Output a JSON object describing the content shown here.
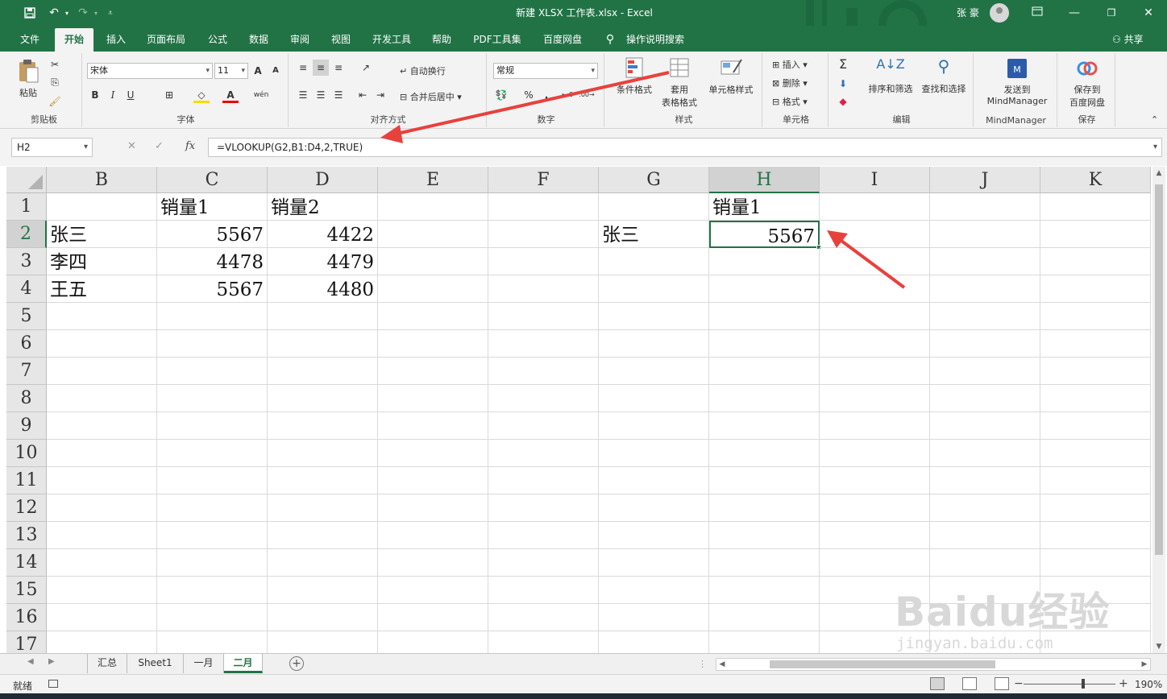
{
  "window": {
    "title": "新建 XLSX 工作表.xlsx  -  Excel",
    "user": "张 豪"
  },
  "menu": {
    "tabs": [
      "文件",
      "开始",
      "插入",
      "页面布局",
      "公式",
      "数据",
      "审阅",
      "视图",
      "开发工具",
      "帮助",
      "PDF工具集",
      "百度网盘",
      "操作说明搜索"
    ],
    "active_tab": "开始",
    "share": "共享"
  },
  "ribbon": {
    "clipboard": {
      "paste": "粘贴",
      "group": "剪贴板"
    },
    "font": {
      "name": "宋体",
      "size": "11",
      "group": "字体",
      "bold": "B",
      "italic": "I",
      "underline": "U",
      "grow": "A",
      "shrink": "A",
      "wen": "wén"
    },
    "alignment": {
      "wrap": "自动换行",
      "merge": "合并后居中",
      "group": "对齐方式"
    },
    "number": {
      "format": "常规",
      "percent": "%",
      "comma": ",",
      "group": "数字"
    },
    "styles": {
      "conditional": "条件格式",
      "table_line1": "套用",
      "table_line2": "表格格式",
      "cell": "单元格样式",
      "group": "样式"
    },
    "cells": {
      "insert": "插入",
      "delete": "删除",
      "format": "格式",
      "group": "单元格"
    },
    "editing": {
      "sort": "排序和筛选",
      "find": "查找和选择",
      "group": "编辑"
    },
    "mindmanager": {
      "line1": "发送到",
      "line2": "MindManager",
      "group": "MindManager"
    },
    "save": {
      "line1": "保存到",
      "line2": "百度网盘",
      "group": "保存"
    }
  },
  "formula_bar": {
    "name_box": "H2",
    "fx": "fx",
    "formula": "=VLOOKUP(G2,B1:D4,2,TRUE)"
  },
  "sheet": {
    "columns": [
      "B",
      "C",
      "D",
      "E",
      "F",
      "G",
      "H",
      "I",
      "J",
      "K"
    ],
    "selected_column": "H",
    "rows": [
      "1",
      "2",
      "3",
      "4",
      "5",
      "6",
      "7",
      "8",
      "9",
      "10",
      "11",
      "12",
      "13",
      "14",
      "15",
      "16",
      "17"
    ],
    "selected_row": "2",
    "cells": {
      "C1": "销量1",
      "D1": "销量2",
      "H1": "销量1",
      "B2": "张三",
      "C2": "5567",
      "D2": "4422",
      "G2": "张三",
      "H2": "5567",
      "B3": "李四",
      "C3": "4478",
      "D3": "4479",
      "B4": "王五",
      "C4": "5567",
      "D4": "4480"
    },
    "active_cell": "H2"
  },
  "sheet_tabs": {
    "tabs": [
      "汇总",
      "Sheet1",
      "一月",
      "二月"
    ],
    "active": "二月"
  },
  "status": {
    "ready": "就绪",
    "zoom": "190%",
    "zoom_level_percent": 190
  },
  "watermark": {
    "logo": "Baidu经验",
    "url": "jingyan.baidu.com"
  },
  "colors": {
    "excel_green": "#217346",
    "annotation_red": "#e8413c"
  }
}
